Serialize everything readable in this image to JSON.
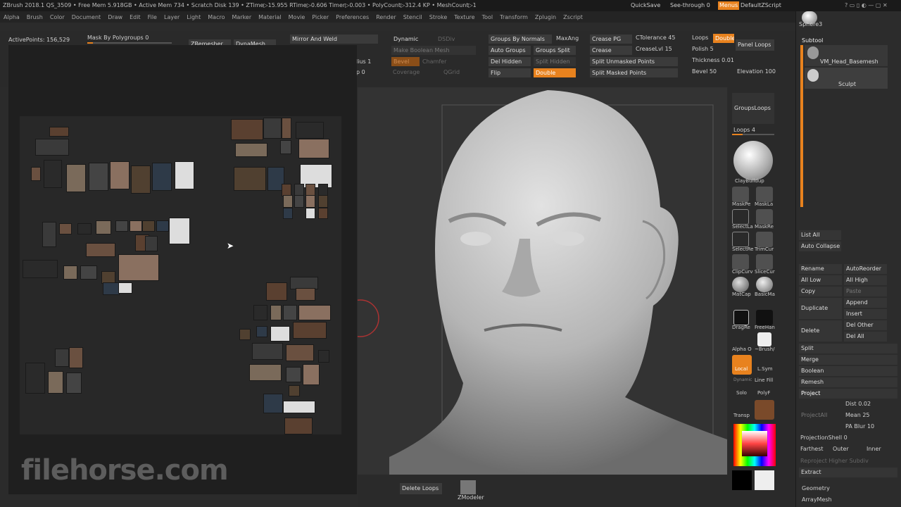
{
  "titlebar": {
    "status": "ZBrush 2018.1   QS_3509   • Free Mem 5.918GB • Active Mem 734 • Scratch Disk 139 • ZTime▷15.955 RTime▷0.606 Timer▷0.003 • PolyCount▷312.4 KP • MeshCount▷1",
    "quicksave": "QuickSave",
    "seethrough": "See-through  0",
    "menus": "Menus",
    "script": "DefaultZScript",
    "sphere": "Sphere3"
  },
  "menu": [
    "Alpha",
    "Brush",
    "Color",
    "Document",
    "Draw",
    "Edit",
    "File",
    "Layer",
    "Light",
    "Macro",
    "Marker",
    "Material",
    "Movie",
    "Picker",
    "Preferences",
    "Render",
    "Stencil",
    "Stroke",
    "Texture",
    "Tool",
    "Transform",
    "Zplugin",
    "Zscript"
  ],
  "toolbar": {
    "active_points": "ActivePoints: 156,529",
    "mask_by_polygroups": "Mask By Polygroups 0",
    "zremesher": "ZRemesher",
    "dynamesh": "DynaMesh",
    "mirror_weld": "Mirror And Weld",
    "radius": "lius 1",
    "p0": "p 0",
    "dynamic": "Dynamic",
    "dsdiv": "DSDiv",
    "make_boolean": "Make Boolean Mesh",
    "bevel": "Bevel",
    "chamfer": "Chamfer",
    "coverage": "Coverage",
    "qgrid": "QGrid",
    "groups_by_normals": "Groups By Normals",
    "maxang": "MaxAng",
    "auto_groups": "Auto Groups",
    "groups_split": "Groups Split",
    "del_hidden": "Del Hidden",
    "split_hidden": "Split Hidden",
    "flip": "Flip",
    "double": "Double",
    "crease_pg": "Crease PG",
    "ctolerance": "CTolerance 45",
    "crease": "Crease",
    "creaselvl": "CreaseLvl 15",
    "split_unmasked": "Split Unmasked Points",
    "split_masked": "Split Masked Points",
    "loops": "Loops",
    "double2": "Double",
    "polish": "Polish 5",
    "thickness": "Thickness 0.01",
    "bevel50": "Bevel 50",
    "elevation": "Elevation 100",
    "panel_loops": "Panel Loops",
    "delete_loops": "Delete Loops",
    "zmodeler": "ZModeler"
  },
  "shelf": {
    "groups_loops": "GroupsLoops",
    "loops4": "Loops 4",
    "clay": "ClayBuildup",
    "maskpen": "MaskPe",
    "masklasso": "MaskLa",
    "selectlasso": "SelectLa",
    "maskrect": "MaskRe",
    "selectrect": "SelectRe",
    "trimcurve": "TrimCur",
    "clipcurve": "ClipCurv",
    "slicecurve": "SliceCur",
    "matcap": "MatCap",
    "basicmat": "BasicMa",
    "dragrect": "DragRe",
    "freehand": "FreeHan",
    "alpha_off": "Alpha O",
    "brush": "~Brush/",
    "local": "Local",
    "lsym": "L.Sym",
    "dynamic": "Dynamic",
    "solo": "Solo",
    "linefill": "Line Fill",
    "polyf": "PolyF",
    "transp": "Transp"
  },
  "subtool": {
    "header": "Subtool",
    "item1": "VM_Head_Basemesh",
    "item2": "Sculpt",
    "list_all": "List All",
    "auto_collapse": "Auto Collapse",
    "rename": "Rename",
    "autoreorder": "AutoReorder",
    "all_low": "All Low",
    "all_high": "All High",
    "copy": "Copy",
    "paste": "Paste",
    "duplicate": "Duplicate",
    "append": "Append",
    "insert": "Insert",
    "delete": "Delete",
    "del_other": "Del Other",
    "del_all": "Del All",
    "split": "Split",
    "merge": "Merge",
    "boolean": "Boolean",
    "remesh": "Remesh",
    "project": "Project",
    "projectall": "ProjectAll",
    "dist": "Dist 0.02",
    "mean": "Mean 25",
    "pablur": "PA Blur 10",
    "projshell": "ProjectionShell 0",
    "farthest": "Farthest",
    "outer": "Outer",
    "inner": "Inner",
    "reproject": "Reproject Higher Subdiv",
    "extract": "Extract",
    "geometry": "Geometry",
    "arraymesh": "ArrayMesh"
  },
  "watermark": "filehorse.com"
}
